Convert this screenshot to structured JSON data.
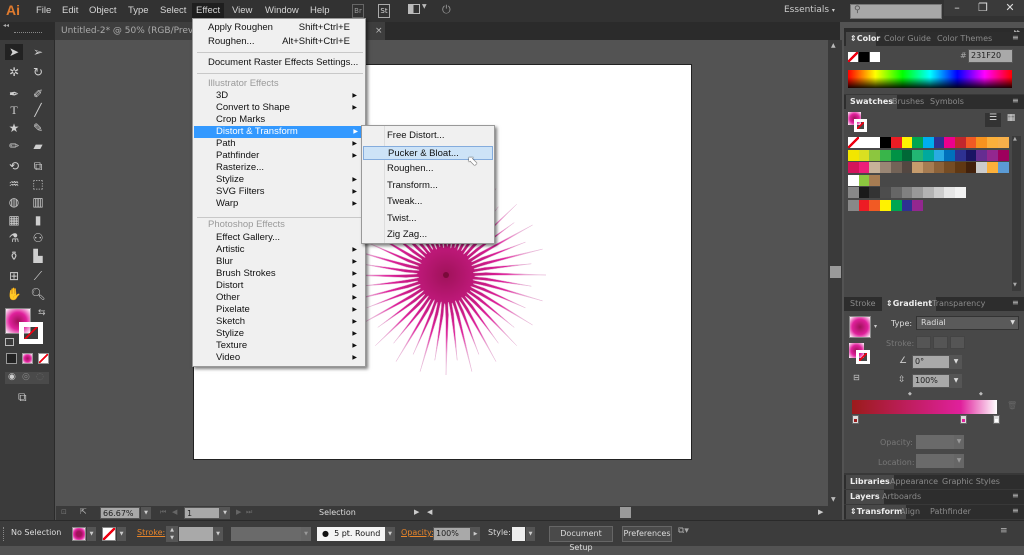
{
  "app": {
    "logo": "Ai",
    "menu": [
      "File",
      "Edit",
      "Object",
      "Type",
      "Select",
      "Effect",
      "View",
      "Window",
      "Help"
    ],
    "active_menu": "Effect",
    "workspace": "Essentials",
    "search_placeholder": "",
    "window_controls": {
      "minimize": "–",
      "restore": "❐",
      "close": "✕"
    },
    "toolbar_icons": {
      "br": "Br",
      "st": "St"
    }
  },
  "document": {
    "tab_title": "Untitled-2* @ 50% (RGB/Preview",
    "close": "×"
  },
  "effect_menu": {
    "top_items": [
      {
        "label": "Apply Roughen",
        "shortcut": "Shift+Ctrl+E"
      },
      {
        "label": "Roughen...",
        "shortcut": "Alt+Shift+Ctrl+E"
      }
    ],
    "raster_settings": "Document Raster Effects Settings...",
    "illustrator_header": "Illustrator Effects",
    "illustrator_items": [
      {
        "label": "3D",
        "sub": true
      },
      {
        "label": "Convert to Shape",
        "sub": true
      },
      {
        "label": "Crop Marks",
        "sub": false
      },
      {
        "label": "Distort & Transform",
        "sub": true,
        "highlight": true
      },
      {
        "label": "Path",
        "sub": true
      },
      {
        "label": "Pathfinder",
        "sub": true
      },
      {
        "label": "Rasterize...",
        "sub": false
      },
      {
        "label": "Stylize",
        "sub": true
      },
      {
        "label": "SVG Filters",
        "sub": true
      },
      {
        "label": "Warp",
        "sub": true
      }
    ],
    "photoshop_header": "Photoshop Effects",
    "photoshop_items": [
      {
        "label": "Effect Gallery...",
        "sub": false
      },
      {
        "label": "Artistic",
        "sub": true
      },
      {
        "label": "Blur",
        "sub": true
      },
      {
        "label": "Brush Strokes",
        "sub": true
      },
      {
        "label": "Distort",
        "sub": true
      },
      {
        "label": "Other",
        "sub": true
      },
      {
        "label": "Pixelate",
        "sub": true
      },
      {
        "label": "Sketch",
        "sub": true
      },
      {
        "label": "Stylize",
        "sub": true
      },
      {
        "label": "Texture",
        "sub": true
      },
      {
        "label": "Video",
        "sub": true
      }
    ]
  },
  "submenu": {
    "items": [
      "Free Distort...",
      "Pucker & Bloat...",
      "Roughen...",
      "Transform...",
      "Tweak...",
      "Twist...",
      "Zig Zag..."
    ],
    "hover": "Pucker & Bloat..."
  },
  "color_panel": {
    "tabs": [
      "Color",
      "Color Guide",
      "Color Themes"
    ],
    "hex": "231F20"
  },
  "swatches_panel": {
    "tabs": [
      "Swatches",
      "Brushes",
      "Symbols"
    ],
    "rows": [
      [
        "#ffffff",
        "#ffffff",
        "#ffffff",
        "#000000",
        "#ed1c24",
        "#fff200",
        "#00a651",
        "#00aeef",
        "#2e3192",
        "#ec008c",
        "#c1272d",
        "#f15a24",
        "#f7931e",
        "#fbb03b",
        "#f7b04a"
      ],
      [
        "#f2e600",
        "#d9e021",
        "#8cc63f",
        "#39b54a",
        "#009245",
        "#006837",
        "#22b573",
        "#00a99d",
        "#29abe2",
        "#0071bc",
        "#2e3192",
        "#1b1464",
        "#662d91",
        "#93278f",
        "#9e005d"
      ],
      [
        "#d4145a",
        "#ed1e79",
        "#c7b299",
        "#998675",
        "#736357",
        "#534741",
        "#c69c6d",
        "#a67c52",
        "#8c6239",
        "#754c24",
        "#603813",
        "#42210b",
        "#cccccc",
        "#fbb03b",
        "#5b9bd5"
      ],
      [
        "#ffffff",
        "#8cc63f",
        "#a67c52"
      ],
      [
        "#888888",
        "#1a1a1a",
        "#333333",
        "#4d4d4d",
        "#666666",
        "#808080",
        "#999999",
        "#b3b3b3",
        "#cccccc",
        "#e6e6e6",
        "#f2f2f2"
      ],
      [
        "#888888",
        "#ed1c24",
        "#f15a24",
        "#fff200",
        "#00a651",
        "#2e3192",
        "#93278f"
      ]
    ]
  },
  "gradient_panel": {
    "tabs": [
      "Stroke",
      "Gradient",
      "Transparency"
    ],
    "type_label": "Type:",
    "type_value": "Radial",
    "stroke_label": "Stroke:",
    "angle": "0°",
    "aspect": "100%",
    "opacity_label": "Opacity:",
    "location_label": "Location:",
    "stops": [
      "#9b1b1b",
      "#e0209c",
      "#ffffff"
    ]
  },
  "collapsed_panels": {
    "row1": [
      "Libraries",
      "Appearance",
      "Graphic Styles"
    ],
    "row2": [
      "Layers",
      "Artboards"
    ],
    "row3": [
      "Transform",
      "Align",
      "Pathfinder"
    ]
  },
  "status": {
    "zoom": "66.67%",
    "artboard": "1",
    "tool": "Selection"
  },
  "control_bar": {
    "selection": "No Selection",
    "stroke_label": "Stroke:",
    "brush": "5 pt. Round",
    "opacity_label": "Opacity:",
    "opacity": "100%",
    "style_label": "Style:",
    "doc_setup": "Document Setup",
    "preferences": "Preferences"
  },
  "artwork": {
    "fill_center": "#a0125a",
    "fill_outer": "#e0209c",
    "spikes": 48
  }
}
